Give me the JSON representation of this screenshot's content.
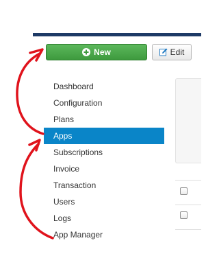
{
  "toolbar": {
    "new_label": "New",
    "new_icon": "plus-circle-icon",
    "edit_label": "Edit",
    "edit_icon": "edit-icon",
    "accent": "#44a744",
    "topbar_color": "#1e3a66"
  },
  "sidebar": {
    "active_color": "#0a85c8",
    "items": [
      {
        "label": "Dashboard"
      },
      {
        "label": "Configuration"
      },
      {
        "label": "Plans"
      },
      {
        "label": "Apps"
      },
      {
        "label": "Subscriptions"
      },
      {
        "label": "Invoice"
      },
      {
        "label": "Transaction"
      },
      {
        "label": "Users"
      },
      {
        "label": "Logs"
      },
      {
        "label": "App Manager"
      }
    ]
  },
  "annotation": {
    "color": "#e0131c"
  }
}
